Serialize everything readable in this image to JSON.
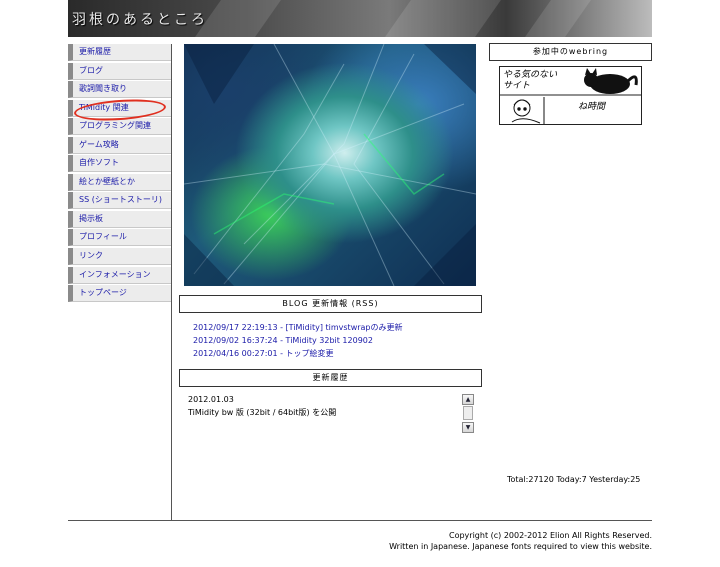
{
  "header": {
    "title": "羽根のあるところ"
  },
  "nav": {
    "items": [
      {
        "label": "更新履歴"
      },
      {
        "label": "ブログ"
      },
      {
        "label": "歌詞聞き取り"
      },
      {
        "label": "TiMidity 関連"
      },
      {
        "label": "プログラミング関連"
      },
      {
        "label": "ゲーム攻略"
      },
      {
        "label": "自作ソフト"
      },
      {
        "label": "絵とか壁紙とか"
      },
      {
        "label": "SS (ショートストーリ)"
      },
      {
        "label": "掲示板"
      },
      {
        "label": "プロフィール"
      },
      {
        "label": "リンク"
      },
      {
        "label": "インフォメーション"
      },
      {
        "label": "トップページ"
      }
    ],
    "highlight_color": "#e03020"
  },
  "blog": {
    "heading": "BLOG 更新情報 (RSS)",
    "entries": [
      {
        "text": "2012/09/17 22:19:13 - [TiMidity] timvstwrapのみ更新"
      },
      {
        "text": "2012/09/02 16:37:24 - TiMidity 32bit 120902"
      },
      {
        "text": "2012/04/16 00:27:01 - トップ絵変更"
      }
    ]
  },
  "history": {
    "heading": "更新履歴",
    "date": "2012.01.03",
    "text": "TiMidity bw 版 (32bit / 64bit版) を公開",
    "scroll_up_icon": "chevron-up-icon",
    "scroll_down_icon": "chevron-down-icon"
  },
  "webring": {
    "heading": "参加中のwebring",
    "banner_text_1": "やる気のないサイト",
    "banner_text_2": "ね時間"
  },
  "counter": {
    "text": "Total:27120 Today:7 Yesterday:25"
  },
  "footer": {
    "copyright": "Copyright (c) 2002-2012 Elion All Rights Reserved.",
    "note": "Written in Japanese. Japanese fonts required to view this website."
  },
  "colors": {
    "link": "#1a1aa8",
    "nav_bg": "#ececec",
    "nav_bar": "#8a8a8a"
  }
}
